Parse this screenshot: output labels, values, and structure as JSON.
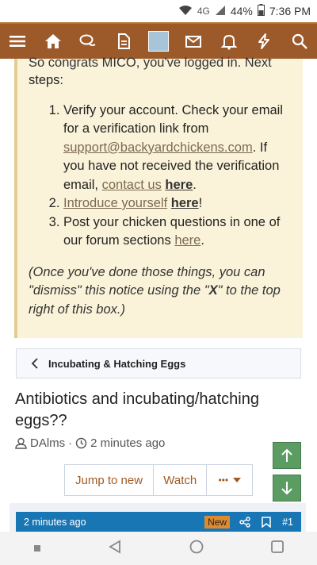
{
  "status_bar": {
    "network": "4G",
    "battery": "44%",
    "time": "7:36 PM"
  },
  "nav": {
    "items": [
      "menu-icon",
      "home-icon",
      "chat-icon",
      "document-icon",
      "avatar",
      "mail-icon",
      "bell-icon",
      "bolt-icon",
      "search-icon"
    ],
    "bar_color": "#9c5a2b"
  },
  "notice": {
    "cut_line": "So congrats MICO, you've logged in. Next",
    "intro": "steps:",
    "step1_text": "Verify your account. Check your email for a verification link from ",
    "step1_email": "support@backyardchickens.com",
    "step1_text2": ". If you have not received the verification email, ",
    "step1_link": "contact us",
    "step1_link_bold": "here",
    "step2_link": "Introduce yourself",
    "step2_link_bold": "here",
    "step2_suffix": "!",
    "step3_text": "Post your chicken questions in one of our forum sections ",
    "step3_link": "here",
    "note_prefix": "(Once you've done those things, you can \"dismiss\" this notice using the \"",
    "note_x": "X",
    "note_suffix": "\" to the top right of this box.)"
  },
  "breadcrumb": {
    "label": "Incubating & Hatching Eggs"
  },
  "thread": {
    "title": "Antibiotics and incubating/hatching eggs??",
    "author": "DAlms",
    "time": "2 minutes ago"
  },
  "buttons": {
    "jump": "Jump to new",
    "watch": "Watch",
    "more": "•••"
  },
  "post": {
    "time": "2 minutes ago",
    "badge": "New",
    "number": "#1",
    "header_color": "#1976b5"
  }
}
